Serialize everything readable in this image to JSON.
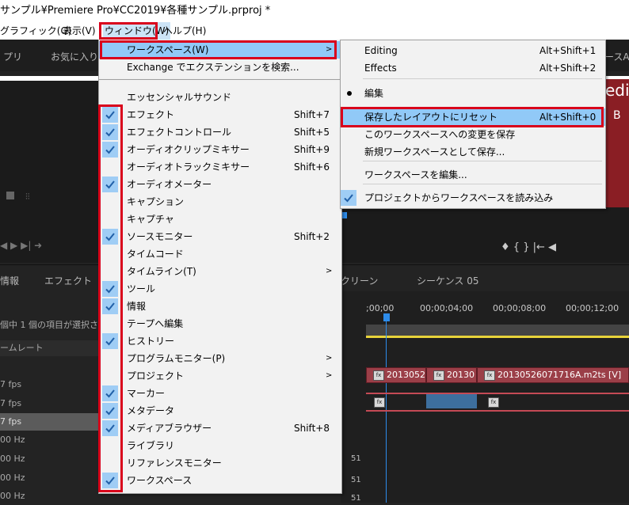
{
  "title": "サンプル¥Premiere Pro¥CC2019¥各種サンプル.prproj *",
  "menubar": [
    "グラフィック(G)",
    "表示(V)",
    "ウィンドウ(W)",
    "ヘルプ(H)"
  ],
  "background": {
    "workspace_tabs": [
      "プリ",
      "お気に入り",
      "ースA"
    ],
    "panel_tabs": [
      "情報",
      "エフェクト",
      "クリーン",
      "シーケンス 05"
    ],
    "selection_text": "個中 1 個の項目が選択され",
    "column_header": "ームレート",
    "rows": [
      "7 fps",
      "7 fps",
      "7 fps",
      "00 Hz",
      "00 Hz",
      "00 Hz",
      "00 Hz"
    ],
    "ruler": [
      ";00;00",
      "00;00;04;00",
      "00;00;08;00",
      "00;00;12;00"
    ],
    "clips": [
      "2013052",
      "20130",
      "20130526071716A.m2ts [V]"
    ],
    "track_labels": [
      "51",
      "51",
      "51"
    ],
    "promo_letters": [
      "edi",
      "B"
    ],
    "colors": {
      "menu_bg": "#f2f2f2",
      "highlight": "#91c9f7",
      "check_bg": "#9fcdf5",
      "red_box": "#d9001b",
      "app_bg": "#232323"
    }
  },
  "window_menu": {
    "workspace": {
      "label": "ワークスペース(W)",
      "has_submenu": true,
      "highlighted": true
    },
    "exchange": {
      "label": "Exchange でエクステンションを検索..."
    },
    "items": [
      {
        "label": "エッセンシャルサウンド",
        "shortcut": "",
        "checked": false,
        "submenu": false
      },
      {
        "label": "エフェクト",
        "shortcut": "Shift+7",
        "checked": true,
        "submenu": false
      },
      {
        "label": "エフェクトコントロール",
        "shortcut": "Shift+5",
        "checked": true,
        "submenu": false
      },
      {
        "label": "オーディオクリップミキサー",
        "shortcut": "Shift+9",
        "checked": true,
        "submenu": false
      },
      {
        "label": "オーディオトラックミキサー",
        "shortcut": "Shift+6",
        "checked": false,
        "submenu": false
      },
      {
        "label": "オーディオメーター",
        "shortcut": "",
        "checked": true,
        "submenu": false
      },
      {
        "label": "キャプション",
        "shortcut": "",
        "checked": false,
        "submenu": false
      },
      {
        "label": "キャプチャ",
        "shortcut": "",
        "checked": false,
        "submenu": false
      },
      {
        "label": "ソースモニター",
        "shortcut": "Shift+2",
        "checked": true,
        "submenu": false
      },
      {
        "label": "タイムコード",
        "shortcut": "",
        "checked": false,
        "submenu": false
      },
      {
        "label": "タイムライン(T)",
        "shortcut": "",
        "checked": false,
        "submenu": true
      },
      {
        "label": "ツール",
        "shortcut": "",
        "checked": true,
        "submenu": false
      },
      {
        "label": "情報",
        "shortcut": "",
        "checked": true,
        "submenu": false
      },
      {
        "label": "テープへ編集",
        "shortcut": "",
        "checked": false,
        "submenu": false
      },
      {
        "label": "ヒストリー",
        "shortcut": "",
        "checked": true,
        "submenu": false
      },
      {
        "label": "プログラムモニター(P)",
        "shortcut": "",
        "checked": false,
        "submenu": true
      },
      {
        "label": "プロジェクト",
        "shortcut": "",
        "checked": false,
        "submenu": true
      },
      {
        "label": "マーカー",
        "shortcut": "",
        "checked": true,
        "submenu": false
      },
      {
        "label": "メタデータ",
        "shortcut": "",
        "checked": true,
        "submenu": false
      },
      {
        "label": "メディアブラウザー",
        "shortcut": "Shift+8",
        "checked": true,
        "submenu": false
      },
      {
        "label": "ライブラリ",
        "shortcut": "",
        "checked": false,
        "submenu": false
      },
      {
        "label": "リファレンスモニター",
        "shortcut": "",
        "checked": false,
        "submenu": false
      },
      {
        "label": "ワークスペース",
        "shortcut": "",
        "checked": true,
        "submenu": false
      }
    ]
  },
  "workspace_submenu": {
    "items": [
      {
        "label": "Editing",
        "shortcut": "Alt+Shift+1",
        "mark": "",
        "highlighted": false
      },
      {
        "label": "Effects",
        "shortcut": "Alt+Shift+2",
        "mark": "",
        "highlighted": false
      },
      {
        "label": "編集",
        "shortcut": "",
        "mark": "dot",
        "highlighted": false
      },
      {
        "label": "保存したレイアウトにリセット",
        "shortcut": "Alt+Shift+0",
        "mark": "",
        "highlighted": true
      },
      {
        "label": "このワークスペースへの変更を保存",
        "shortcut": "",
        "mark": "",
        "highlighted": false
      },
      {
        "label": "新規ワークスペースとして保存...",
        "shortcut": "",
        "mark": "",
        "highlighted": false
      },
      {
        "label": "ワークスペースを編集...",
        "shortcut": "",
        "mark": "",
        "highlighted": false
      },
      {
        "label": "プロジェクトからワークスペースを読み込み",
        "shortcut": "",
        "mark": "check",
        "highlighted": false
      }
    ]
  }
}
